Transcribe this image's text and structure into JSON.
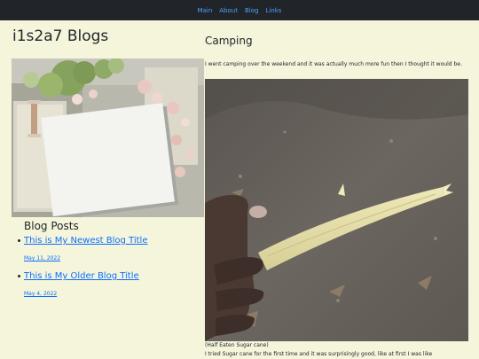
{
  "nav": {
    "items": [
      "Main",
      "About",
      "Blog",
      "Links"
    ]
  },
  "site": {
    "title": "i1s2a7 Blogs"
  },
  "sidebar": {
    "heading": "Blog Posts",
    "posts": [
      {
        "title": "This is My Newest Blog Title",
        "date": "May 11, 2022"
      },
      {
        "title": "This is My Older Blog Title",
        "date": "May 4, 2022"
      }
    ]
  },
  "article": {
    "title": "Camping",
    "intro": "I went camping over the weekend and it was actually much more fun then I thought it would be.",
    "caption": "(Half Eaten Sugar cane)",
    "body": "I tried Sugar cane for the first time and it was surprisingly good, like at first I was like"
  },
  "colors": {
    "page_background": "#f5f5dc",
    "navbar": "#212529",
    "nav_link": "#4d9fff",
    "link": "#0d6efd"
  }
}
